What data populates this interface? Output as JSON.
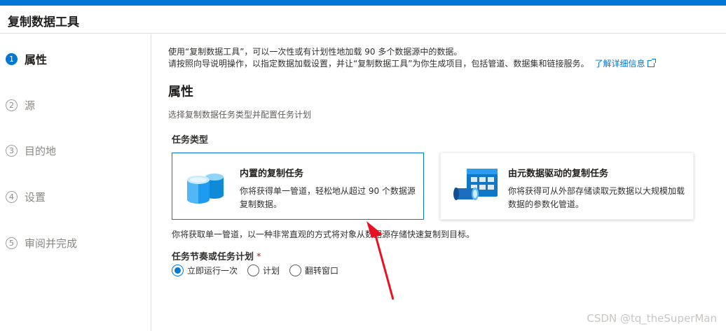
{
  "header": {
    "title": "复制数据工具"
  },
  "steps": [
    {
      "num": "1",
      "label": "属性"
    },
    {
      "num": "2",
      "label": "源"
    },
    {
      "num": "3",
      "label": "目的地"
    },
    {
      "num": "4",
      "label": "设置"
    },
    {
      "num": "5",
      "label": "审阅并完成"
    }
  ],
  "intro": {
    "line1": "使用“复制数据工具”，可以一次性或有计划性地加载 90 多个数据源中的数据。",
    "line2": "请按照向导说明操作，以指定数据加载设置，并让“复制数据工具”为你生成项目，包括管道、数据集和链接服务。",
    "link": "了解详细信息"
  },
  "section": {
    "title": "属性",
    "subtitle": "选择复制数据任务类型并配置任务计划"
  },
  "task_type": {
    "label": "任务类型",
    "cards": [
      {
        "title": "内置的复制任务",
        "desc": "你将获得单一管道，轻松地从超过 90 个数据源复制数据。",
        "icon": "database-cylinders-icon",
        "selected": true
      },
      {
        "title": "由元数据驱动的复制任务",
        "desc": "你将获得可从外部存储读取元数据以大规模加载数据的参数化管道。",
        "icon": "metadata-table-pipe-icon",
        "selected": false
      }
    ]
  },
  "explain": "你将获取单一管道，以一种非常直观的方式将对象从数据源存储快速复制到目标。",
  "schedule": {
    "label": "任务节奏或任务计划",
    "required_mark": "*",
    "options": [
      {
        "label": "立即运行一次",
        "checked": true
      },
      {
        "label": "计划",
        "checked": false
      },
      {
        "label": "翻转窗口",
        "checked": false
      }
    ]
  },
  "watermark": "CSDN @tq_theSuperMan",
  "colors": {
    "accent": "#0078d4",
    "annotation_arrow": "#e81123"
  }
}
